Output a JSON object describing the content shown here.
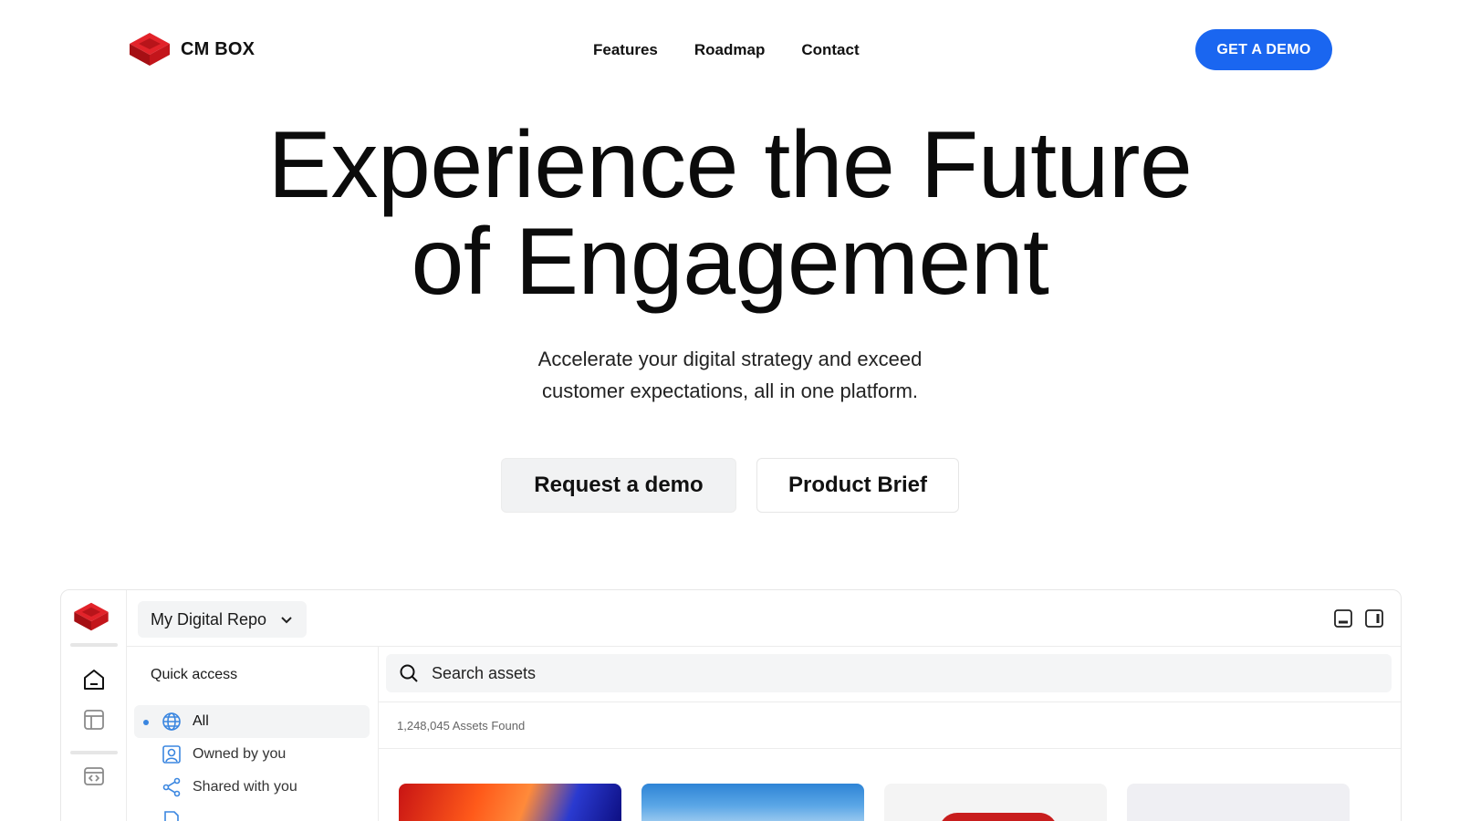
{
  "brand": {
    "name": "CM BOX",
    "logo_icon": "red-cube-logo-icon",
    "brand_color": "#d3161c"
  },
  "nav": {
    "links": [
      "Features",
      "Roadmap",
      "Contact"
    ],
    "cta_label": "GET A DEMO",
    "cta_color": "#1a66f0"
  },
  "hero": {
    "title_line1": "Experience the Future",
    "title_line2": "of Engagement",
    "subtitle_line1": "Accelerate your digital strategy and exceed",
    "subtitle_line2": "customer expectations, all in one platform.",
    "primary_button": "Request a demo",
    "secondary_button": "Product Brief"
  },
  "app": {
    "repo_select": "My Digital Repo",
    "rail_icons": [
      "home-icon",
      "layout-icon",
      "embed-icon"
    ],
    "view_icons": [
      "panel-bottom-icon",
      "panel-right-icon"
    ],
    "sidebar": {
      "heading": "Quick access",
      "items": [
        {
          "label": "All",
          "icon": "globe-icon",
          "active": true
        },
        {
          "label": "Owned by you",
          "icon": "user-square-icon",
          "active": false
        },
        {
          "label": "Shared with you",
          "icon": "share-icon",
          "active": false
        },
        {
          "label": "",
          "icon": "file-icon",
          "active": false
        }
      ]
    },
    "search": {
      "placeholder": "Search assets"
    },
    "asset_count": "1,248,045 Assets Found"
  }
}
